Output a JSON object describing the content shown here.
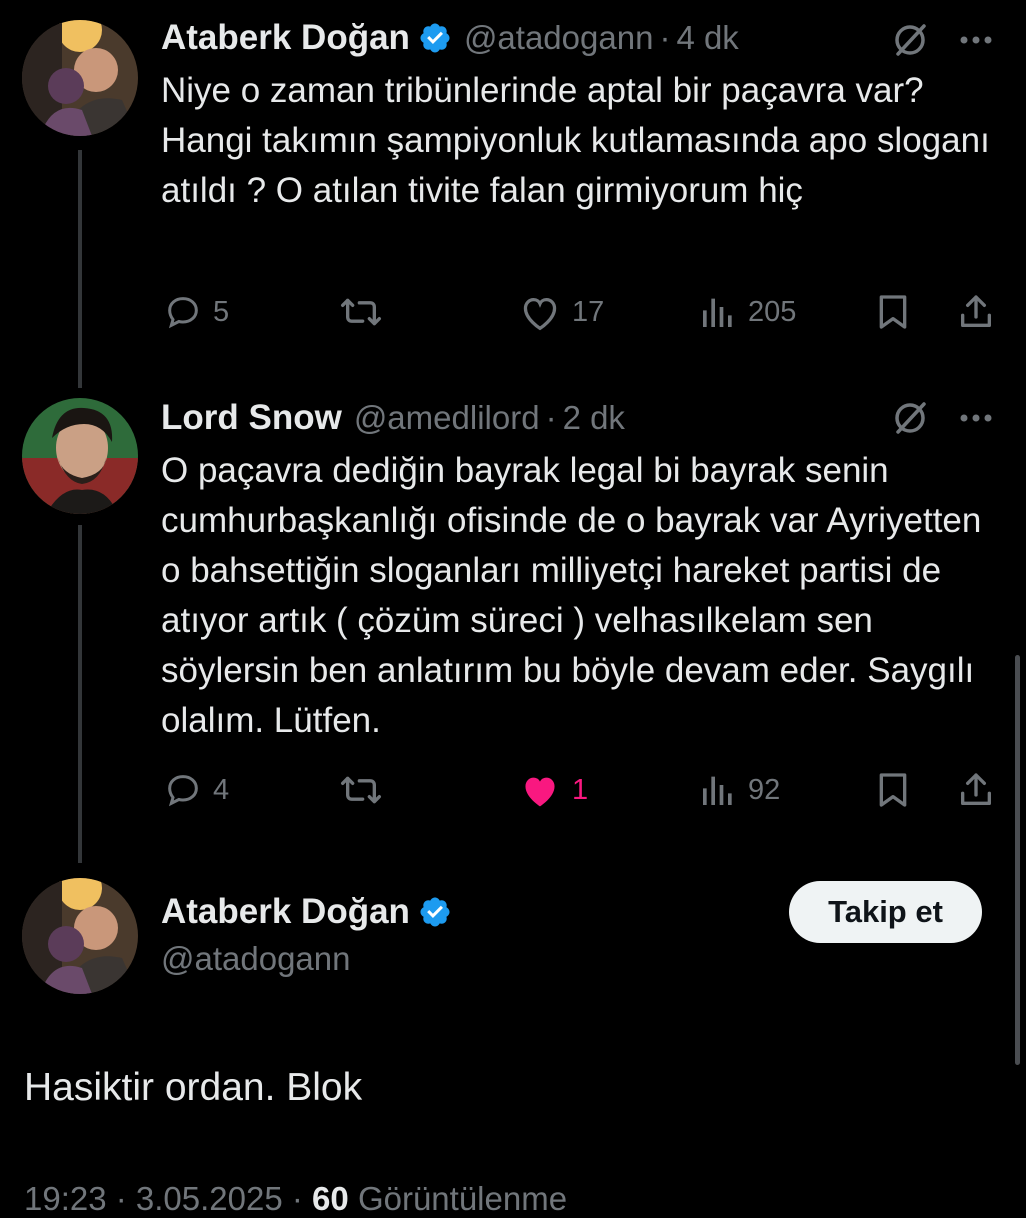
{
  "tweets": [
    {
      "name": "Ataberk Doğan",
      "handle": "@atadogann",
      "separator": "·",
      "time": "4 dk",
      "verified": true,
      "text": "Niye o zaman tribünlerinde aptal bir paçavra var? Hangi takımın şampiyonluk kutlamasında apo sloganı atıldı ? O atılan tivite falan girmiyorum hiç",
      "replies": "5",
      "retweets": "",
      "likes": "17",
      "views": "205",
      "liked": false
    },
    {
      "name": "Lord Snow",
      "handle": "@amedlilord",
      "separator": "·",
      "time": "2 dk",
      "verified": false,
      "text": "O paçavra dediğin bayrak legal bi bayrak senin cumhurbaşkanlığı ofisinde de o bayrak var Ayriyetten o bahsettiğin sloganları milliyetçi hareket partisi de atıyor artık ( çözüm süreci ) velhasılkelam sen söylersin ben anlatırım bu böyle devam eder. Saygılı olalım. Lütfen.",
      "replies": "4",
      "retweets": "",
      "likes": "1",
      "views": "92",
      "liked": true
    }
  ],
  "main_tweet": {
    "name": "Ataberk Doğan",
    "handle": "@atadogann",
    "follow_label": "Takip et",
    "text": "Hasiktir ordan. Blok",
    "meta_time": "19:23 · 3.05.2025 ·",
    "meta_views": "60",
    "meta_views_label": "Görüntülenme"
  },
  "colors": {
    "background": "#000000",
    "text": "#e7e9ea",
    "secondary": "#71767b",
    "verified": "#1d9bf0",
    "like_active": "#f91880"
  },
  "icons": {
    "grok": "grok-icon",
    "more": "more-icon",
    "reply": "reply-icon",
    "retweet": "retweet-icon",
    "like": "heart-icon",
    "views": "views-icon",
    "bookmark": "bookmark-icon",
    "share": "share-icon"
  }
}
